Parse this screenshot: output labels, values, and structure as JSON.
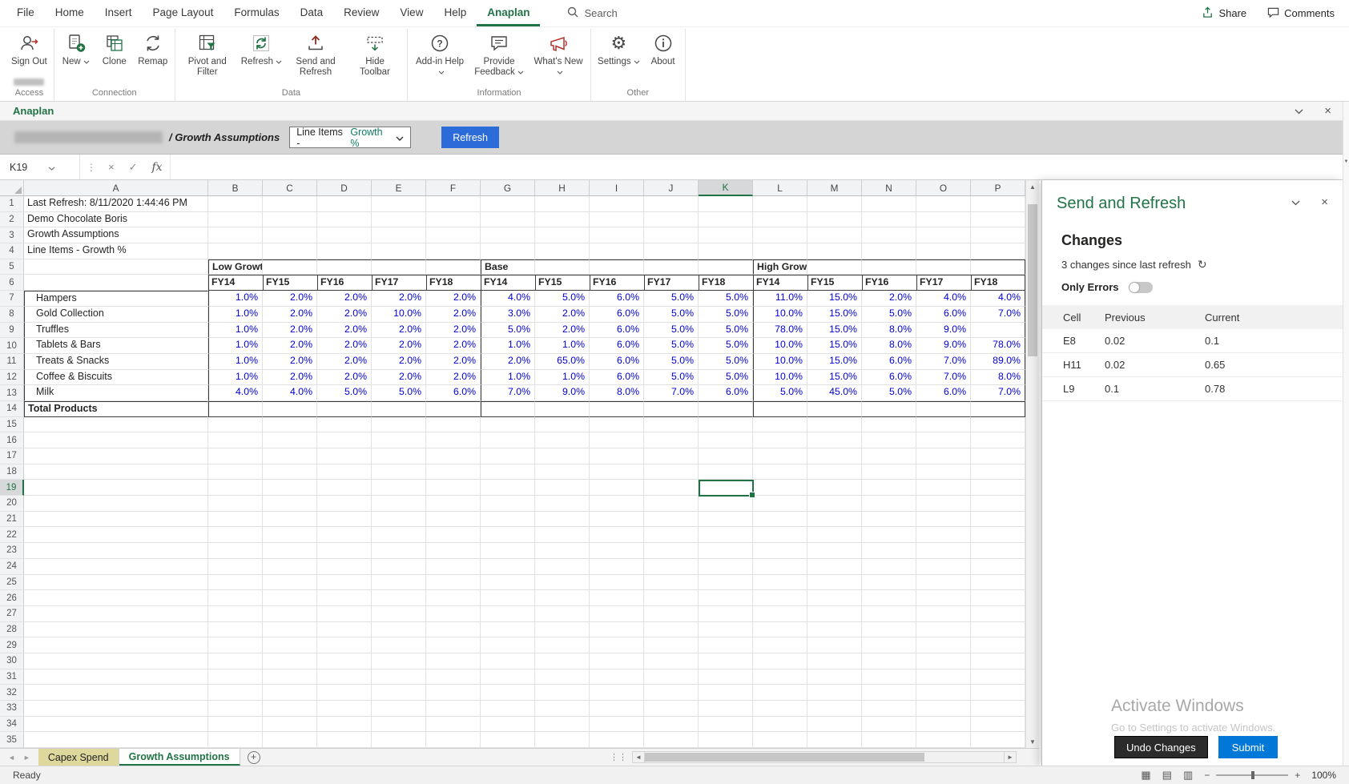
{
  "window": {
    "share": "Share",
    "comments": "Comments"
  },
  "menu": {
    "tabs": [
      {
        "label": "File",
        "active": false
      },
      {
        "label": "Home",
        "active": false
      },
      {
        "label": "Insert",
        "active": false
      },
      {
        "label": "Page Layout",
        "active": false
      },
      {
        "label": "Formulas",
        "active": false
      },
      {
        "label": "Data",
        "active": false
      },
      {
        "label": "Review",
        "active": false
      },
      {
        "label": "View",
        "active": false
      },
      {
        "label": "Help",
        "active": false
      },
      {
        "label": "Anaplan",
        "active": true
      }
    ],
    "search": "Search"
  },
  "ribbon": {
    "groups": [
      {
        "name": "Access",
        "buttons": [
          {
            "label": "Sign Out",
            "icon": "sign-out",
            "dropdown": false
          }
        ]
      },
      {
        "name": "Connection",
        "buttons": [
          {
            "label": "New",
            "icon": "new",
            "dropdown": true
          },
          {
            "label": "Clone",
            "icon": "clone",
            "dropdown": false
          },
          {
            "label": "Remap",
            "icon": "remap",
            "dropdown": false
          }
        ]
      },
      {
        "name": "Data",
        "buttons": [
          {
            "label": "Pivot and Filter",
            "icon": "pivot",
            "dropdown": false
          },
          {
            "label": "Refresh",
            "icon": "refresh",
            "dropdown": true
          },
          {
            "label": "Send and Refresh",
            "icon": "send-refresh",
            "dropdown": false
          },
          {
            "label": "Hide Toolbar",
            "icon": "hide-toolbar",
            "dropdown": false
          }
        ]
      },
      {
        "name": "Information",
        "buttons": [
          {
            "label": "Add-in Help",
            "icon": "help",
            "dropdown": true
          },
          {
            "label": "Provide Feedback",
            "icon": "feedback",
            "dropdown": true
          },
          {
            "label": "What's New",
            "icon": "whats-new",
            "dropdown": true
          }
        ]
      },
      {
        "name": "Other",
        "buttons": [
          {
            "label": "Settings",
            "icon": "settings",
            "dropdown": true
          },
          {
            "label": "About",
            "icon": "about",
            "dropdown": false
          }
        ]
      }
    ]
  },
  "anaplan_pane": {
    "title": "Anaplan",
    "breadcrumb": "/ Growth Assumptions",
    "view_prefix": "Line Items - ",
    "view_value": "Growth %",
    "refresh": "Refresh"
  },
  "formula_bar": {
    "name_box": "K19",
    "fx": "fx"
  },
  "grid": {
    "columns": [
      "A",
      "B",
      "C",
      "D",
      "E",
      "F",
      "G",
      "H",
      "I",
      "J",
      "K",
      "L",
      "M",
      "N",
      "O",
      "P"
    ],
    "row_count": 35,
    "selection": {
      "cell": "K19",
      "column": "K",
      "row": 19
    },
    "info_rows": [
      "Last Refresh: 8/11/2020 1:44:46 PM",
      "Demo Chocolate Boris",
      "Growth Assumptions",
      "Line Items - Growth %"
    ],
    "scenarios": [
      "Low Growt",
      "Base",
      "High Grow"
    ],
    "year_headers": [
      "FY14",
      "FY15",
      "FY16",
      "FY17",
      "FY18"
    ],
    "products": [
      {
        "name": "Hampers",
        "values": [
          "1.0%",
          "2.0%",
          "2.0%",
          "2.0%",
          "2.0%",
          "4.0%",
          "5.0%",
          "6.0%",
          "5.0%",
          "5.0%",
          "11.0%",
          "15.0%",
          "2.0%",
          "4.0%",
          "4.0%"
        ]
      },
      {
        "name": "Gold Collection",
        "values": [
          "1.0%",
          "2.0%",
          "2.0%",
          "10.0%",
          "2.0%",
          "3.0%",
          "2.0%",
          "6.0%",
          "5.0%",
          "5.0%",
          "10.0%",
          "15.0%",
          "5.0%",
          "6.0%",
          "7.0%"
        ]
      },
      {
        "name": "Truffles",
        "values": [
          "1.0%",
          "2.0%",
          "2.0%",
          "2.0%",
          "2.0%",
          "5.0%",
          "2.0%",
          "6.0%",
          "5.0%",
          "5.0%",
          "78.0%",
          "15.0%",
          "8.0%",
          "9.0%",
          ""
        ]
      },
      {
        "name": "Tablets & Bars",
        "values": [
          "1.0%",
          "2.0%",
          "2.0%",
          "2.0%",
          "2.0%",
          "1.0%",
          "1.0%",
          "6.0%",
          "5.0%",
          "5.0%",
          "10.0%",
          "15.0%",
          "8.0%",
          "9.0%",
          "78.0%"
        ]
      },
      {
        "name": "Treats & Snacks",
        "values": [
          "1.0%",
          "2.0%",
          "2.0%",
          "2.0%",
          "2.0%",
          "2.0%",
          "65.0%",
          "6.0%",
          "5.0%",
          "5.0%",
          "10.0%",
          "15.0%",
          "6.0%",
          "7.0%",
          "89.0%"
        ]
      },
      {
        "name": "Coffee & Biscuits",
        "values": [
          "1.0%",
          "2.0%",
          "2.0%",
          "2.0%",
          "2.0%",
          "1.0%",
          "1.0%",
          "6.0%",
          "5.0%",
          "5.0%",
          "10.0%",
          "15.0%",
          "6.0%",
          "7.0%",
          "8.0%"
        ]
      },
      {
        "name": "Milk",
        "values": [
          "4.0%",
          "4.0%",
          "5.0%",
          "5.0%",
          "6.0%",
          "7.0%",
          "9.0%",
          "8.0%",
          "7.0%",
          "6.0%",
          "5.0%",
          "45.0%",
          "5.0%",
          "6.0%",
          "7.0%"
        ]
      }
    ],
    "total_row_label": "Total Products"
  },
  "sheet_tabs": {
    "tabs": [
      {
        "label": "Capex Spend",
        "active": false
      },
      {
        "label": "Growth Assumptions",
        "active": true
      }
    ]
  },
  "status_bar": {
    "ready": "Ready",
    "zoom": "100%"
  },
  "panel": {
    "title": "Send and Refresh",
    "changes_heading": "Changes",
    "changes_status": "3 changes since last refresh",
    "only_errors": "Only Errors",
    "table": {
      "headers": [
        "Cell",
        "Previous",
        "Current"
      ],
      "rows": [
        {
          "cell": "E8",
          "previous": "0.02",
          "current": "0.1"
        },
        {
          "cell": "H11",
          "previous": "0.02",
          "current": "0.65"
        },
        {
          "cell": "L9",
          "previous": "0.1",
          "current": "0.78"
        }
      ]
    },
    "undo": "Undo Changes",
    "submit": "Submit",
    "watermark": [
      "Activate Windows",
      "Go to Settings to activate Windows."
    ]
  }
}
